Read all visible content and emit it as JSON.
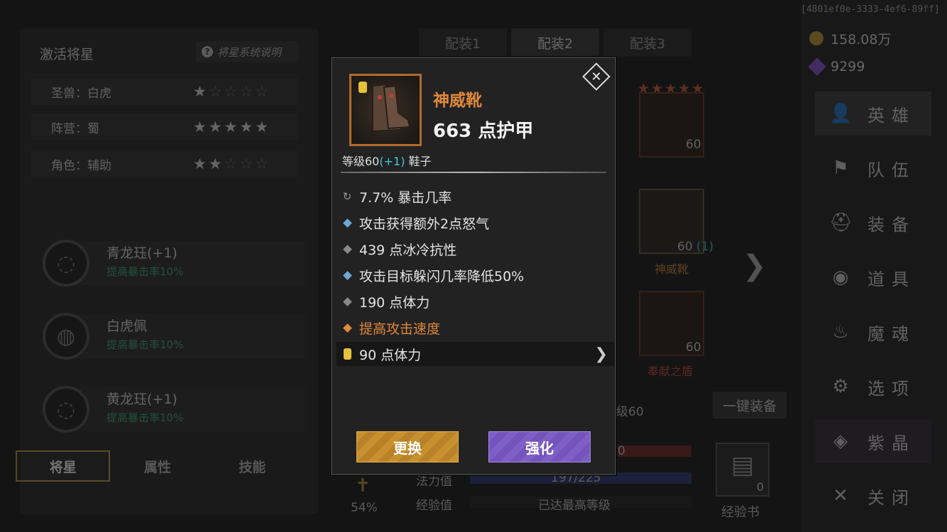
{
  "top_id": "[4801ef0e-3333-4ef6-89ff]",
  "left_panel": {
    "title": "激活将星",
    "help_label": "将星系统说明",
    "rows": [
      {
        "label": "圣兽：白虎",
        "stars": 1
      },
      {
        "label": "阵营：蜀",
        "stars": 5
      },
      {
        "label": "角色：辅助",
        "stars": 2
      }
    ],
    "jades": [
      {
        "name": "青龙珏(+1)",
        "effect": "提高暴击率10%"
      },
      {
        "name": "白虎佩",
        "effect": "提高暴击率10%"
      },
      {
        "name": "黄龙珏(+1)",
        "effect": "提高暴击率10%"
      }
    ],
    "tabs": [
      "将星",
      "属性",
      "技能"
    ]
  },
  "config_tabs": [
    "配装1",
    "配装2",
    "配装3"
  ],
  "background": {
    "slot1_level": "60",
    "slot2_level": "60",
    "slot2_plus": "(1)",
    "slot2_name": "神威靴",
    "slot3_level": "60",
    "slot3_name": "奉献之盾",
    "level_text": "级60",
    "one_click": "一键装备",
    "mana_label": "法力值",
    "mana_value": "197/225",
    "exp_label": "经验值",
    "exp_value": "已达最高等级",
    "percent": "54%",
    "exp_book_label": "经验书",
    "exp_book_count": "0",
    "hp_tail": "0"
  },
  "currency": {
    "gold": "158.08万",
    "gems": "9299"
  },
  "nav": [
    {
      "label": "英雄",
      "icon": "hero-icon"
    },
    {
      "label": "队伍",
      "icon": "flag-icon"
    },
    {
      "label": "装备",
      "icon": "helmet-icon"
    },
    {
      "label": "道具",
      "icon": "bag-icon"
    },
    {
      "label": "魔魂",
      "icon": "flame-icon"
    },
    {
      "label": "选项",
      "icon": "gear-icon"
    },
    {
      "label": "紫晶",
      "icon": "crystal-icon"
    },
    {
      "label": "关闭",
      "icon": "close-icon"
    }
  ],
  "modal": {
    "item_name": "神威靴",
    "armor": "663 点护甲",
    "level_prefix": "等级60",
    "level_plus": "(+1)",
    "item_type": "鞋子",
    "stats": [
      {
        "text": "7.7% 暴击几率",
        "marker": "refresh"
      },
      {
        "text": "攻击获得额外2点怒气",
        "marker": "blue"
      },
      {
        "text": "439 点冰冷抗性",
        "marker": "grey"
      },
      {
        "text": "攻击目标躲闪几率降低50%",
        "marker": "blue"
      },
      {
        "text": "190 点体力",
        "marker": "grey"
      },
      {
        "text": "提高攻击速度",
        "marker": "orange"
      },
      {
        "text": "90 点体力",
        "marker": "gold"
      }
    ],
    "replace_button": "更换",
    "enhance_button": "强化"
  },
  "colors": {
    "item_name": "#e0883a",
    "jade_effect": "#3fae7f",
    "level_plus": "#46c7d8",
    "gold_button": "#c8902e",
    "purple_button": "#7e5fc6"
  }
}
